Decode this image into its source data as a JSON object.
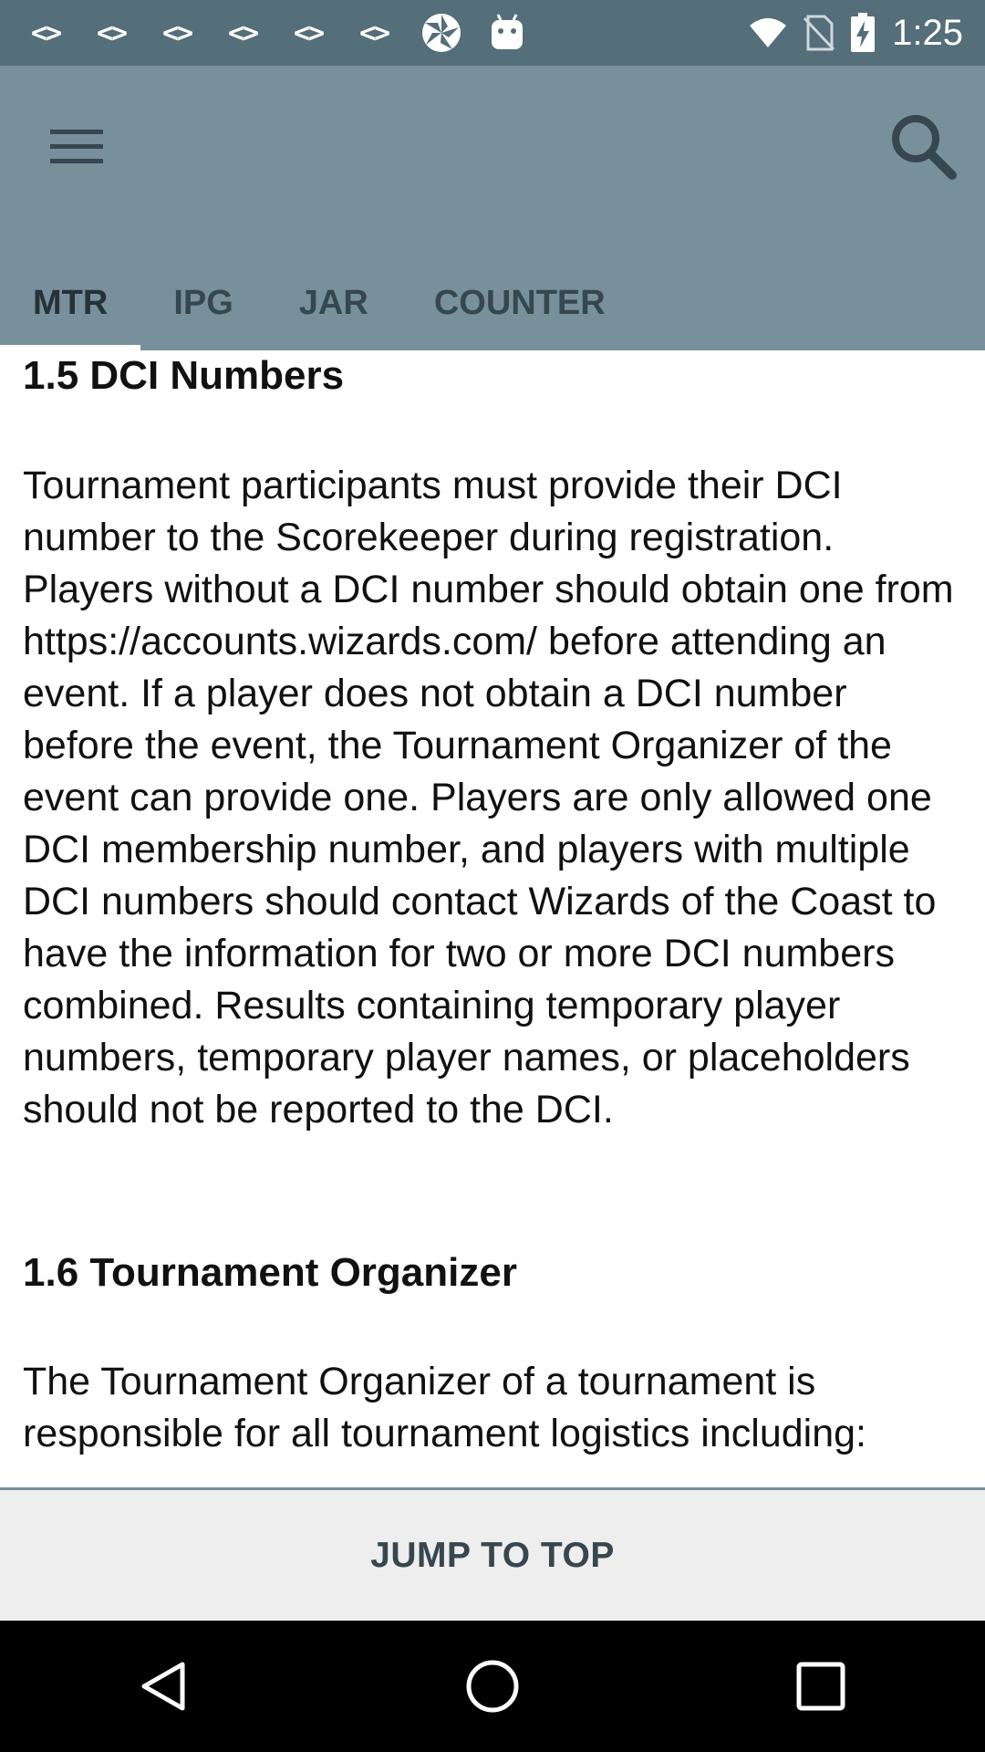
{
  "status_bar": {
    "notification_icons": [
      "<>",
      "<>",
      "<>",
      "<>",
      "<>",
      "<>"
    ],
    "app_icons": [
      "pinwheel-icon",
      "android-icon"
    ],
    "time": "1:25"
  },
  "app_bar": {
    "tabs": [
      {
        "label": "MTR",
        "active": true
      },
      {
        "label": "IPG",
        "active": false
      },
      {
        "label": "JAR",
        "active": false
      },
      {
        "label": "COUNTER",
        "active": false
      }
    ]
  },
  "content": {
    "section1_title": "1.5 DCI Numbers",
    "section1_text": "Tournament participants must provide their DCI number to the Scorekeeper during registration. Players without a DCI number should obtain one from https://accounts.wizards.com/ before attending an event. If a player does not obtain a DCI number before the event, the Tournament Organizer of the event can provide one. Players are only allowed one DCI membership number, and players with multiple DCI numbers should contact Wizards of the Coast to have the information for two or more DCI numbers combined. Results containing temporary player numbers, temporary player names, or placeholders should not be reported to the DCI.",
    "section2_title": "1.6 Tournament Organizer",
    "section2_text": "The Tournament Organizer of a tournament is responsible for all tournament logistics including:"
  },
  "jump_to_top_label": "JUMP TO TOP",
  "colors": {
    "status_bar": "#546e7a",
    "app_bar": "#78909c",
    "tab_text": "#37474f",
    "active_tab_indicator": "#ffffff"
  }
}
